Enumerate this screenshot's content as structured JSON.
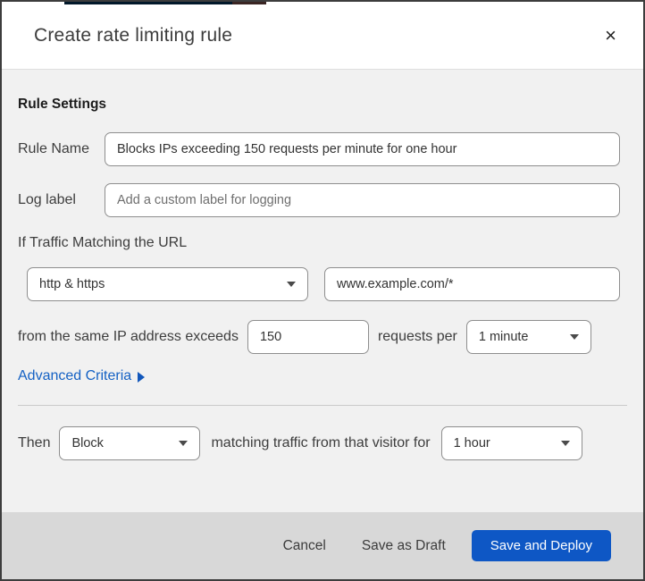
{
  "dialog": {
    "title": "Create rate limiting rule",
    "close_glyph": "×"
  },
  "rule_settings": {
    "section_title": "Rule Settings",
    "rule_name": {
      "label": "Rule Name",
      "value": "Blocks IPs exceeding 150 requests per minute for one hour"
    },
    "log_label": {
      "label": "Log label",
      "placeholder": "Add a custom label for logging"
    }
  },
  "match": {
    "intro": "If Traffic Matching the URL",
    "scheme_selected": "http & https",
    "url_value": "www.example.com/*",
    "threshold_prefix": "from the same IP address exceeds",
    "request_count": "150",
    "threshold_middle": "requests per",
    "period_selected": "1 minute",
    "advanced_criteria_label": "Advanced Criteria"
  },
  "action": {
    "then_label": "Then",
    "action_selected": "Block",
    "middle_text": "matching traffic from that visitor for",
    "duration_selected": "1 hour"
  },
  "footer": {
    "cancel_label": "Cancel",
    "save_draft_label": "Save as Draft",
    "save_deploy_label": "Save and Deploy"
  },
  "colors": {
    "primary_button_blue": "#0e57c5",
    "link_blue": "#1461c4",
    "body_background": "#f1f1f1",
    "footer_background": "#d8d8d8"
  }
}
